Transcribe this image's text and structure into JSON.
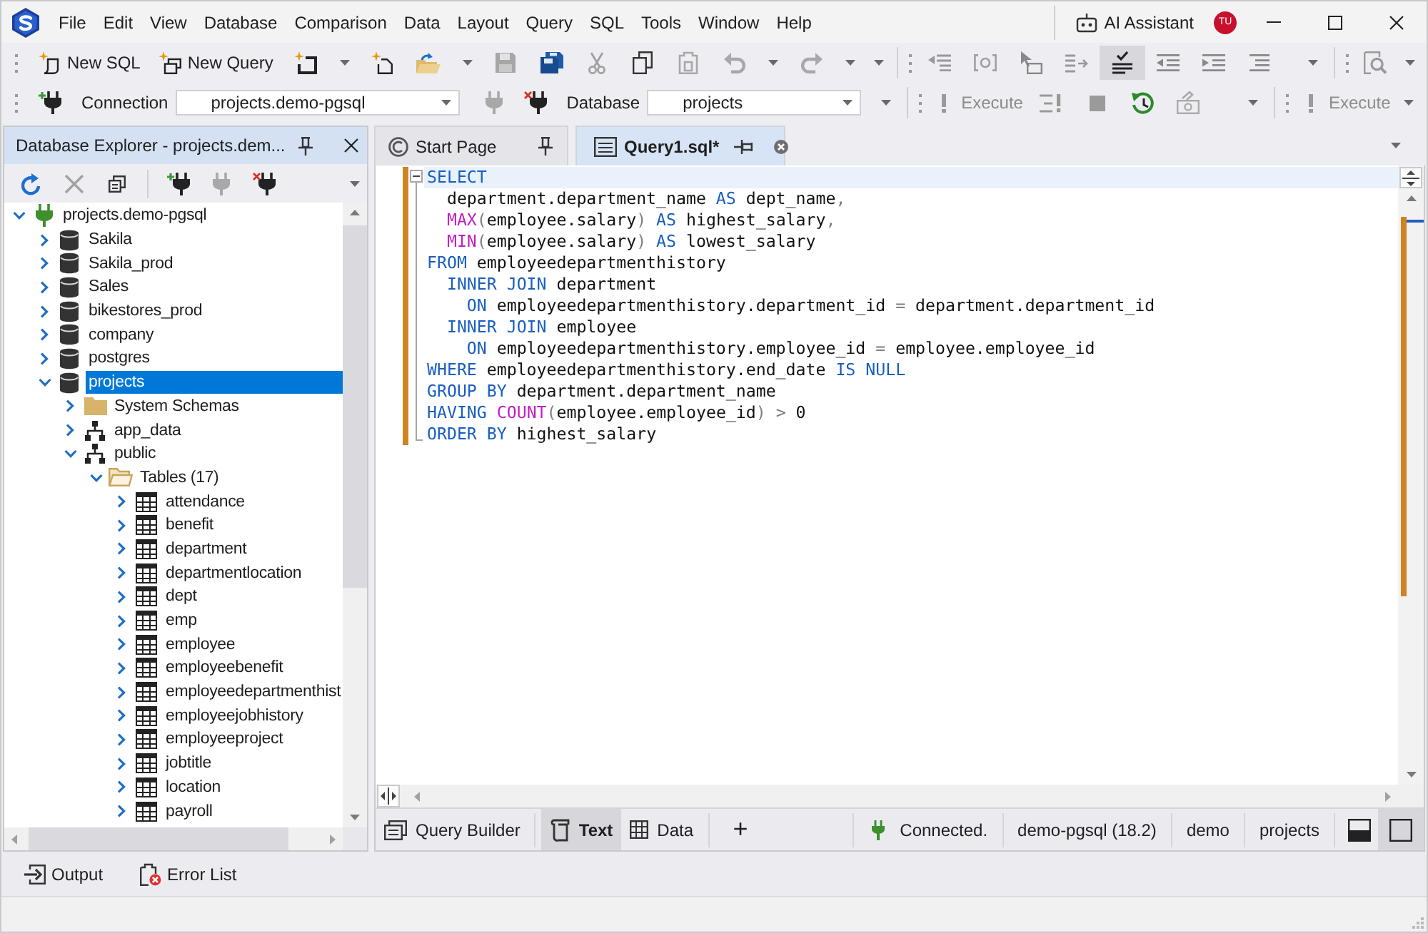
{
  "title_bar": {
    "menu": [
      "File",
      "Edit",
      "View",
      "Database",
      "Comparison",
      "Data",
      "Layout",
      "Query",
      "SQL",
      "Tools",
      "Window",
      "Help"
    ],
    "ai_assistant": "AI Assistant",
    "user_initials": "TU"
  },
  "standard_toolbar": {
    "new_buttons": [
      "New SQL",
      "New Query"
    ],
    "sql_check_on": true
  },
  "connection_toolbar": {
    "connection_label": "Connection",
    "connection": "projects.demo-pgsql",
    "database_label": "Database",
    "database": "projects",
    "execute_buttons": [
      {
        "label": "Execute",
        "disabled": true
      },
      {
        "label": "Execute",
        "disabled": true
      }
    ]
  },
  "database_explorer": {
    "title": "Database Explorer - projects.dem...",
    "tree": [
      {
        "label": "projects.demo-pgsql",
        "kind": "connection",
        "expanded": true,
        "selected": false,
        "children": [
          {
            "label": "Sakila",
            "kind": "database",
            "expanded": false,
            "selected": false
          },
          {
            "label": "Sakila_prod",
            "kind": "database",
            "expanded": false,
            "selected": false
          },
          {
            "label": "Sales",
            "kind": "database",
            "expanded": false,
            "selected": false
          },
          {
            "label": "bikestores_prod",
            "kind": "database",
            "expanded": false,
            "selected": false
          },
          {
            "label": "company",
            "kind": "database",
            "expanded": false,
            "selected": false
          },
          {
            "label": "postgres",
            "kind": "database",
            "expanded": false,
            "selected": false
          },
          {
            "label": "projects",
            "kind": "database",
            "expanded": true,
            "selected": true,
            "children": [
              {
                "label": "System Schemas",
                "kind": "folder",
                "expanded": false,
                "selected": false
              },
              {
                "label": "app_data",
                "kind": "schema",
                "expanded": false,
                "selected": false
              },
              {
                "label": "public",
                "kind": "schema",
                "expanded": true,
                "selected": false,
                "children": [
                  {
                    "label": "Tables (17)",
                    "kind": "folder",
                    "expanded": true,
                    "selected": false,
                    "children": [
                      {
                        "label": "attendance",
                        "kind": "table",
                        "expanded": false,
                        "selected": false
                      },
                      {
                        "label": "benefit",
                        "kind": "table",
                        "expanded": false,
                        "selected": false
                      },
                      {
                        "label": "department",
                        "kind": "table",
                        "expanded": false,
                        "selected": false
                      },
                      {
                        "label": "departmentlocation",
                        "kind": "table",
                        "expanded": false,
                        "selected": false
                      },
                      {
                        "label": "dept",
                        "kind": "table",
                        "expanded": false,
                        "selected": false
                      },
                      {
                        "label": "emp",
                        "kind": "table",
                        "expanded": false,
                        "selected": false
                      },
                      {
                        "label": "employee",
                        "kind": "table",
                        "expanded": false,
                        "selected": false
                      },
                      {
                        "label": "employeebenefit",
                        "kind": "table",
                        "expanded": false,
                        "selected": false
                      },
                      {
                        "label": "employeedepartmenthist",
                        "kind": "table",
                        "expanded": false,
                        "selected": false
                      },
                      {
                        "label": "employeejobhistory",
                        "kind": "table",
                        "expanded": false,
                        "selected": false
                      },
                      {
                        "label": "employeeproject",
                        "kind": "table",
                        "expanded": false,
                        "selected": false
                      },
                      {
                        "label": "jobtitle",
                        "kind": "table",
                        "expanded": false,
                        "selected": false
                      },
                      {
                        "label": "location",
                        "kind": "table",
                        "expanded": false,
                        "selected": false
                      },
                      {
                        "label": "payroll",
                        "kind": "table",
                        "expanded": false,
                        "selected": false
                      }
                    ]
                  }
                ]
              }
            ]
          }
        ]
      }
    ]
  },
  "document_tabs": [
    {
      "label": "Start Page",
      "kind": "start_page",
      "selected": false,
      "pinned": true
    },
    {
      "label": "Query1.sql*",
      "kind": "sql_document",
      "selected": true,
      "pinned": false
    }
  ],
  "editor": {
    "fold_expanded": true,
    "unsaved_changes": true,
    "lines": [
      {
        "current": true,
        "tokens": [
          {
            "kind": "keyword",
            "text": "SELECT"
          }
        ]
      },
      {
        "current": false,
        "tokens": [
          {
            "kind": "name",
            "text": "  department.department_name "
          },
          {
            "kind": "keyword",
            "text": "AS"
          },
          {
            "kind": "name",
            "text": " dept_name"
          },
          {
            "kind": "punct",
            "text": ","
          }
        ]
      },
      {
        "current": false,
        "tokens": [
          {
            "kind": "function",
            "text": "  MAX"
          },
          {
            "kind": "punct",
            "text": "("
          },
          {
            "kind": "name",
            "text": "employee.salary"
          },
          {
            "kind": "punct",
            "text": ")"
          },
          {
            "kind": "keyword",
            "text": " AS"
          },
          {
            "kind": "name",
            "text": " highest_salary"
          },
          {
            "kind": "punct",
            "text": ","
          }
        ]
      },
      {
        "current": false,
        "tokens": [
          {
            "kind": "function",
            "text": "  MIN"
          },
          {
            "kind": "punct",
            "text": "("
          },
          {
            "kind": "name",
            "text": "employee.salary"
          },
          {
            "kind": "punct",
            "text": ")"
          },
          {
            "kind": "keyword",
            "text": " AS"
          },
          {
            "kind": "name",
            "text": " lowest_salary"
          }
        ]
      },
      {
        "current": false,
        "tokens": [
          {
            "kind": "keyword",
            "text": "FROM"
          },
          {
            "kind": "name",
            "text": " employeedepartmenthistory"
          }
        ]
      },
      {
        "current": false,
        "tokens": [
          {
            "kind": "keyword",
            "text": "  INNER JOIN"
          },
          {
            "kind": "name",
            "text": " department"
          }
        ]
      },
      {
        "current": false,
        "tokens": [
          {
            "kind": "keyword",
            "text": "    ON"
          },
          {
            "kind": "name",
            "text": " employeedepartmenthistory.department_id "
          },
          {
            "kind": "punct",
            "text": "="
          },
          {
            "kind": "name",
            "text": " department.department_id"
          }
        ]
      },
      {
        "current": false,
        "tokens": [
          {
            "kind": "keyword",
            "text": "  INNER JOIN"
          },
          {
            "kind": "name",
            "text": " employee"
          }
        ]
      },
      {
        "current": false,
        "tokens": [
          {
            "kind": "keyword",
            "text": "    ON"
          },
          {
            "kind": "name",
            "text": " employeedepartmenthistory.employee_id "
          },
          {
            "kind": "punct",
            "text": "="
          },
          {
            "kind": "name",
            "text": " employee.employee_id"
          }
        ]
      },
      {
        "current": false,
        "tokens": [
          {
            "kind": "keyword",
            "text": "WHERE"
          },
          {
            "kind": "name",
            "text": " employeedepartmenthistory.end_date "
          },
          {
            "kind": "keyword",
            "text": "IS NULL"
          }
        ]
      },
      {
        "current": false,
        "tokens": [
          {
            "kind": "keyword",
            "text": "GROUP BY"
          },
          {
            "kind": "name",
            "text": " department.department_name"
          }
        ]
      },
      {
        "current": false,
        "tokens": [
          {
            "kind": "keyword",
            "text": "HAVING "
          },
          {
            "kind": "function",
            "text": "COUNT"
          },
          {
            "kind": "punct",
            "text": "("
          },
          {
            "kind": "name",
            "text": "employee.employee_id"
          },
          {
            "kind": "punct",
            "text": ")"
          },
          {
            "kind": "punct",
            "text": " >"
          },
          {
            "kind": "name",
            "text": " 0"
          }
        ]
      },
      {
        "current": false,
        "tokens": [
          {
            "kind": "keyword",
            "text": "ORDER BY"
          },
          {
            "kind": "name",
            "text": " highest_salary"
          }
        ]
      }
    ]
  },
  "view_tabs": [
    {
      "label": "Query Builder",
      "kind": "query_builder",
      "selected": false
    },
    {
      "label": "Text",
      "kind": "text",
      "selected": true
    },
    {
      "label": "Data",
      "kind": "data",
      "selected": false
    }
  ],
  "add_view": "+",
  "status": {
    "connection_state": "Connected.",
    "connection_name": "demo-pgsql (18.2)",
    "user": "demo",
    "database": "projects"
  },
  "layout_buttons": [
    {
      "kind": "bottom_pane",
      "selected": false
    },
    {
      "kind": "full",
      "selected": true
    }
  ],
  "tool_windows": [
    {
      "label": "Output",
      "kind": "output"
    },
    {
      "label": "Error List",
      "kind": "error_list"
    }
  ]
}
